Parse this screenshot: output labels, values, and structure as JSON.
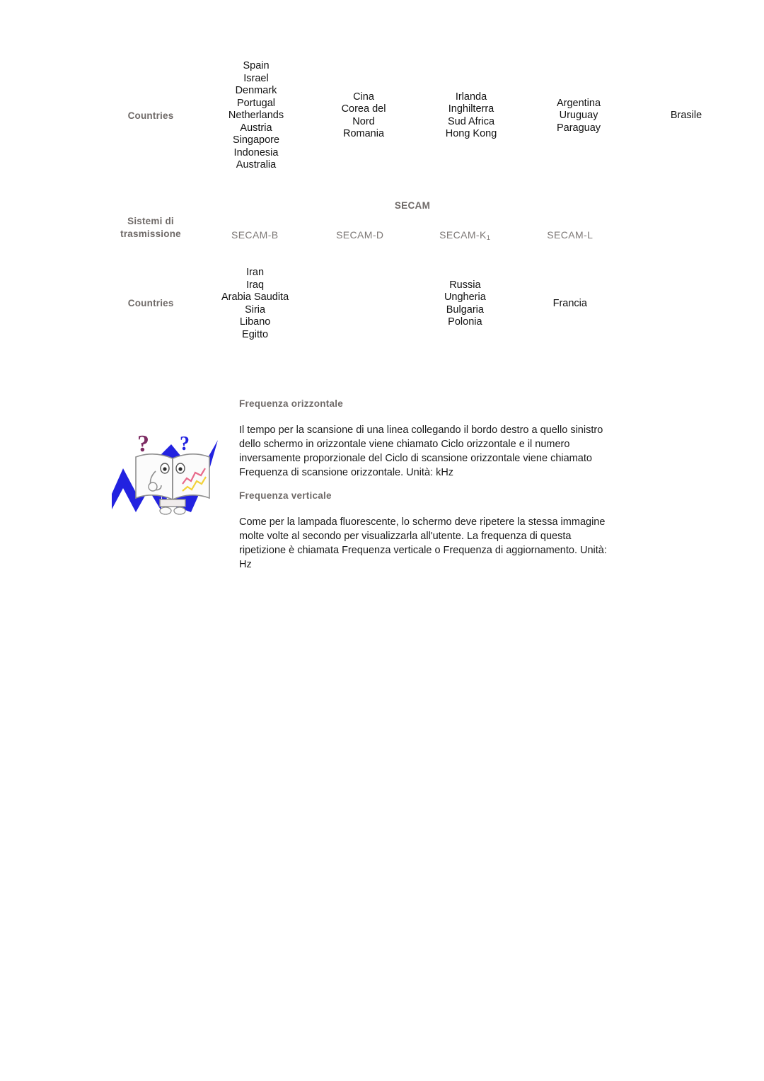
{
  "tables": {
    "countries_pal": {
      "row_label": "Countries",
      "columns": [
        {
          "countries": [
            "Spain",
            "Israel",
            "Denmark",
            "Portugal",
            "Netherlands",
            "Austria",
            "Singapore",
            "Indonesia",
            "Australia"
          ]
        },
        {
          "countries": [
            "Cina",
            "Corea del",
            "Nord",
            "Romania"
          ]
        },
        {
          "countries": [
            "Irlanda",
            "Inghilterra",
            "Sud Africa",
            "Hong Kong"
          ]
        },
        {
          "countries": [
            "Argentina",
            "Uruguay",
            "Paraguay"
          ]
        },
        {
          "countries": [
            "Brasile"
          ]
        }
      ]
    },
    "transmission_systems": {
      "row_label_line1": "Sistemi di",
      "row_label_line2": "trasmissione",
      "group_title": "SECAM",
      "column_labels": [
        {
          "base": "SECAM-B",
          "sub": ""
        },
        {
          "base": "SECAM-D",
          "sub": ""
        },
        {
          "base": "SECAM-K",
          "sub": "1"
        },
        {
          "base": "SECAM-L",
          "sub": ""
        }
      ]
    },
    "countries_secam": {
      "row_label": "Countries",
      "columns": [
        {
          "countries": [
            "Iran",
            "Iraq",
            "Arabia Saudita",
            "Siria",
            "Libano",
            "Egitto"
          ]
        },
        {
          "countries": []
        },
        {
          "countries": [
            "Russia",
            "Ungheria",
            "Bulgaria",
            "Polonia"
          ]
        },
        {
          "countries": [
            "Francia"
          ]
        }
      ]
    }
  },
  "info_sections": {
    "horizontal": {
      "heading": "Frequenza orizzontale",
      "body": "Il tempo per la scansione di una linea collegando il bordo destro a quello sinistro dello schermo in orizzontale viene chiamato Ciclo orizzontale e il numero inversamente proporzionale del Ciclo di scansione orizzontale viene chiamato Frequenza di scansione orizzontale. Unità: kHz"
    },
    "vertical": {
      "heading": "Frequenza verticale",
      "body": "Come per la lampada fluorescente, lo schermo deve ripetere la stessa immagine molte volte al secondo per visualizzarla all'utente. La frequenza di questa ripetizione è chiamata Frequenza verticale o Frequenza di aggiornamento. Unità: Hz"
    }
  },
  "icon": {
    "name": "help-book-icon",
    "colors": {
      "bolt": "#2222e0",
      "question_left": "#7d2c63",
      "question_right": "#2222e0",
      "book": "#fbfbfb",
      "book_outline": "#8a8a8a",
      "accent_red": "#e86a8a",
      "accent_yellow": "#f2d23a"
    }
  },
  "theme": {
    "background": "#ffffff",
    "label_gray": "#6f6a68",
    "column_label_gray": "#7d7876",
    "body_text": "#111111"
  }
}
